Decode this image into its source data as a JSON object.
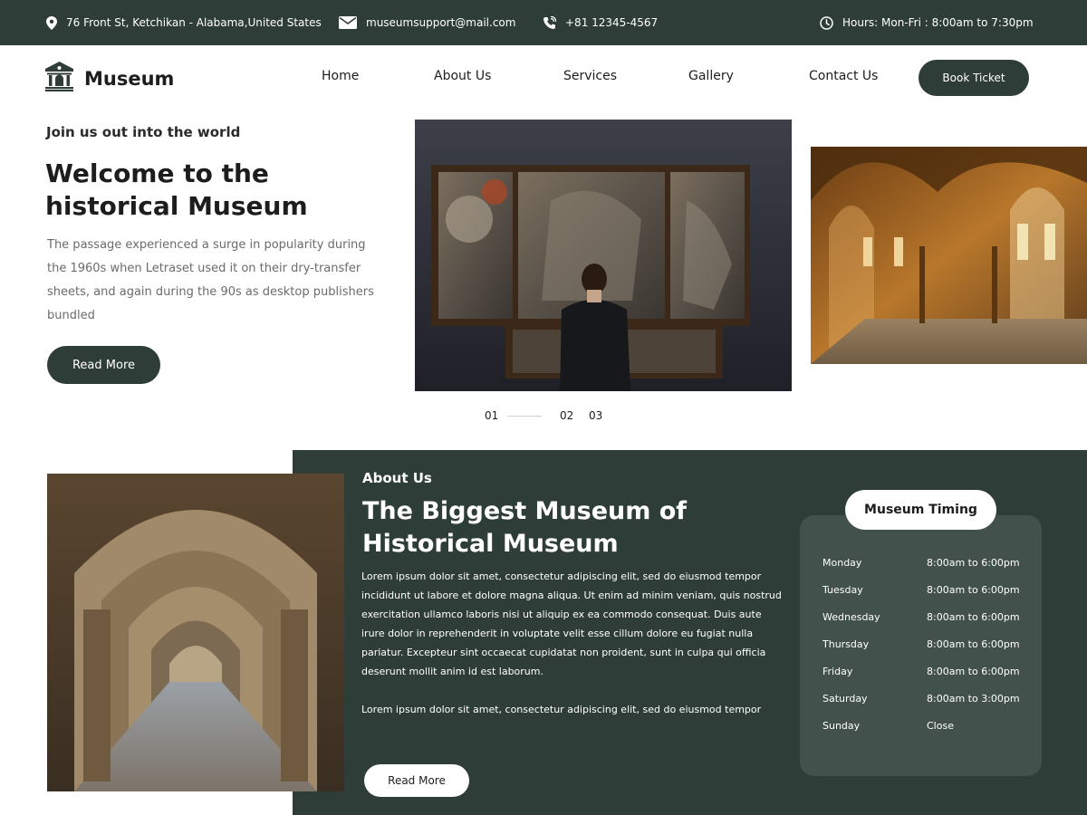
{
  "topbar": {
    "address": "76 Front St, Ketchikan - Alabama,United States",
    "email": "museumsupport@mail.com",
    "phone": "+81 12345-4567",
    "hours": "Hours: Mon-Fri : 8:00am to 7:30pm"
  },
  "brand": {
    "name": "Museum",
    "icon": "museum-building-icon"
  },
  "nav": {
    "items": [
      "Home",
      "About Us",
      "Services",
      "Gallery",
      "Contact Us"
    ],
    "cta": "Book Ticket"
  },
  "hero": {
    "subtitle": "Join us out into the world",
    "title_line1": "Welcome to the",
    "title_line2": "historical Museum",
    "description": "The passage experienced a surge in popularity during the 1960s when Letraset used it on their dry-transfer sheets, and again during the 90s as desktop publishers bundled",
    "button": "Read More",
    "slides": [
      "01",
      "02",
      "03"
    ]
  },
  "about": {
    "label": "About Us",
    "title_line1": "The Biggest Museum of",
    "title_line2": "Historical Museum",
    "paragraph1": "Lorem ipsum dolor sit amet, consectetur adipiscing elit, sed do eiusmod tempor incididunt ut labore et dolore magna aliqua. Ut enim ad minim veniam, quis nostrud exercitation ullamco laboris nisi ut aliquip ex ea commodo consequat. Duis aute irure dolor in reprehenderit in voluptate velit esse cillum dolore eu fugiat nulla pariatur. Excepteur sint occaecat cupidatat non proident, sunt in culpa qui officia deserunt mollit anim id est laborum.",
    "paragraph2": "Lorem ipsum dolor sit amet, consectetur adipiscing elit, sed do eiusmod tempor",
    "button": "Read More"
  },
  "timing": {
    "title": "Museum Timing",
    "rows": [
      {
        "day": "Monday",
        "hours": "8:00am to 6:00pm"
      },
      {
        "day": "Tuesday",
        "hours": "8:00am to 6:00pm"
      },
      {
        "day": "Wednesday",
        "hours": "8:00am to 6:00pm"
      },
      {
        "day": "Thursday",
        "hours": "8:00am to 6:00pm"
      },
      {
        "day": "Friday",
        "hours": "8:00am to 6:00pm"
      },
      {
        "day": "Saturday",
        "hours": "8:00am to 3:00pm"
      },
      {
        "day": "Sunday",
        "hours": "Close"
      }
    ]
  },
  "colors": {
    "primary": "#2f3d39",
    "card": "#43514d",
    "text": "#1d1d1d",
    "muted": "#6b6b6b"
  }
}
